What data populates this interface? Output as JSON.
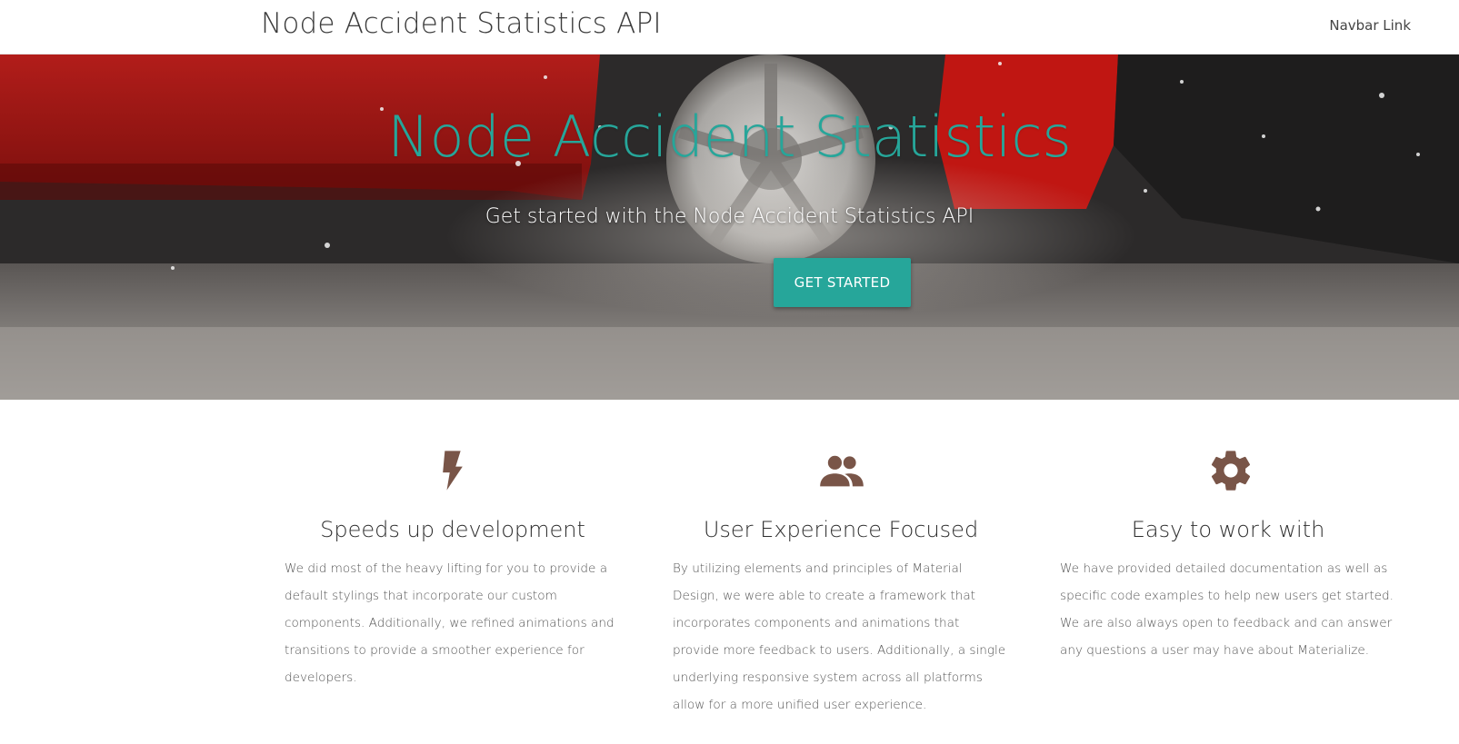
{
  "navbar": {
    "brand": "Node Accident Statistics API",
    "link_label": "Navbar Link"
  },
  "hero": {
    "title": "Node Accident Statistics",
    "subtitle": "Get started with the Node Accident Statistics API",
    "cta_label": "GET STARTED",
    "image": "car-crash-photo"
  },
  "features": [
    {
      "icon": "flash-icon",
      "title": "Speeds up development",
      "text": "We did most of the heavy lifting for you to provide a default stylings that incorporate our custom components. Additionally, we refined animations and transitions to provide a smoother experience for developers."
    },
    {
      "icon": "group-icon",
      "title": "User Experience Focused",
      "text": "By utilizing elements and principles of Material Design, we were able to create a framework that incorporates components and animations that provide more feedback to users. Additionally, a single underlying responsive system across all platforms allow for a more unified user experience."
    },
    {
      "icon": "settings-icon",
      "title": "Easy to work with",
      "text": "We have provided detailed documentation as well as specific code examples to help new users get started. We are also always open to feedback and can answer any questions a user may have about Materialize."
    }
  ],
  "colors": {
    "accent": "#26a69a",
    "icon": "#795548"
  }
}
